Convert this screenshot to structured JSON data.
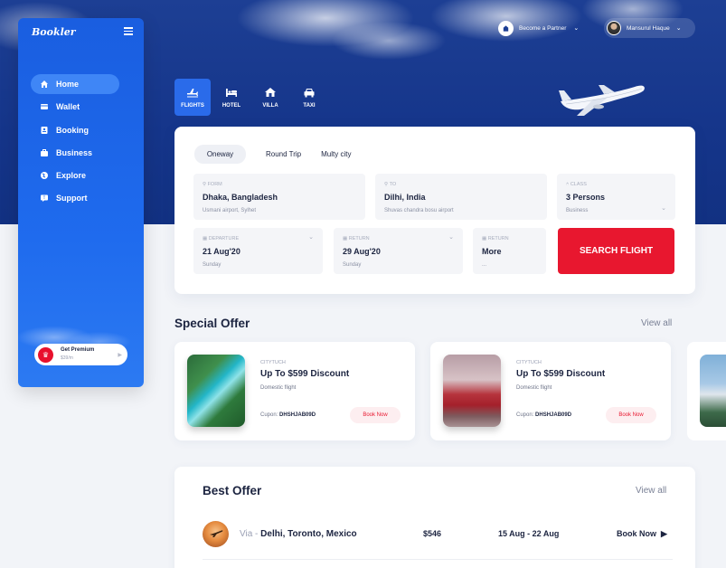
{
  "brand": {
    "logo": "Bookler"
  },
  "sidebar": {
    "items": [
      {
        "label": "Home",
        "icon": "home-icon"
      },
      {
        "label": "Wallet",
        "icon": "wallet-icon"
      },
      {
        "label": "Booking",
        "icon": "booking-icon"
      },
      {
        "label": "Business",
        "icon": "briefcase-icon"
      },
      {
        "label": "Explore",
        "icon": "globe-icon"
      },
      {
        "label": "Support",
        "icon": "support-icon"
      }
    ],
    "premium": {
      "title": "Get Premium",
      "price": "$39/m"
    }
  },
  "header": {
    "partner_label": "Become a Partner",
    "user_name": "Mansurul Haque"
  },
  "categories": [
    {
      "label": "FLIGHTS",
      "icon": "plane-icon"
    },
    {
      "label": "HOTEL",
      "icon": "bed-icon"
    },
    {
      "label": "VILLA",
      "icon": "house-icon"
    },
    {
      "label": "TAXI",
      "icon": "car-icon"
    }
  ],
  "search": {
    "trip_types": [
      "Oneway",
      "Round Trip",
      "Multy city"
    ],
    "from": {
      "label": "FORM",
      "value": "Dhaka, Bangladesh",
      "sub": "Usmani airport, Sylhet"
    },
    "to": {
      "label": "TO",
      "value": "Dilhi, India",
      "sub": "Shuvas chandra bosu airport"
    },
    "class": {
      "label": "CLASS",
      "value": "3 Persons",
      "sub": "Business"
    },
    "departure": {
      "label": "DEPARTURE",
      "value": "21 Aug'20",
      "sub": "Sunday"
    },
    "return": {
      "label": "RETURN",
      "value": "29 Aug'20",
      "sub": "Sunday"
    },
    "more": {
      "label": "RETURN",
      "value": "More",
      "sub": "..."
    },
    "button": "SEARCH FLIGHT"
  },
  "special_offer": {
    "title": "Special Offer",
    "view_all": "View all",
    "offers": [
      {
        "brand": "CITYTUCH",
        "title": "Up To $599 Discount",
        "desc": "Domestic flight",
        "coupon_label": "Cupon:",
        "coupon_code": "DHSHJAB09D",
        "book": "Book Now"
      },
      {
        "brand": "CITYTUCH",
        "title": "Up To $599 Discount",
        "desc": "Domestic flight",
        "coupon_label": "Cupon:",
        "coupon_code": "DHSHJAB09D",
        "book": "Book Now"
      }
    ]
  },
  "best_offer": {
    "title": "Best Offer",
    "view_all": "View all",
    "rows": [
      {
        "via": "Via - ",
        "route": "Delhi, Toronto, Mexico",
        "price": "$546",
        "dates": "15 Aug - 22 Aug",
        "book": "Book Now"
      }
    ]
  }
}
